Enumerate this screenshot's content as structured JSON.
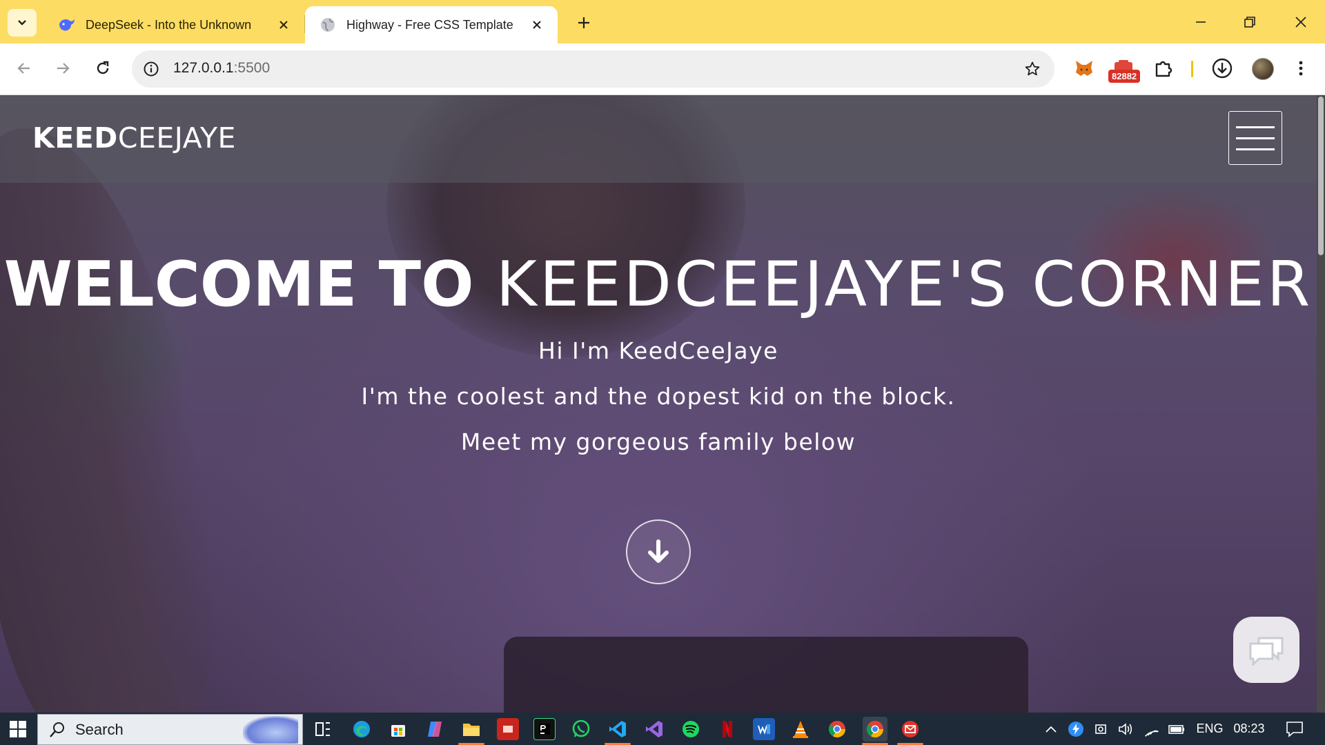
{
  "browser": {
    "tabs": [
      {
        "title": "DeepSeek - Into the Unknown",
        "favicon": "deepseek-whale-icon",
        "active": false
      },
      {
        "title": "Highway - Free CSS Template",
        "favicon": "globe-icon",
        "active": true
      }
    ],
    "address": {
      "host": "127.0.0.1",
      "port": ":5500"
    },
    "extension_badge": "82882",
    "colors": {
      "tabstrip": "#fcdc63",
      "active_tab": "#ffffff",
      "badge": "#d93025"
    }
  },
  "site": {
    "logo_bold": "KEED",
    "logo_light": "CEEJAYE",
    "hero": {
      "title_bold": "WELCOME TO",
      "title_light": "KEEDCEEJAYE'S CORNER",
      "lines": [
        "Hi I'm KeedCeeJaye",
        "I'm the coolest and the dopest kid on the block.",
        "Meet my gorgeous family below"
      ]
    }
  },
  "taskbar": {
    "search_label": "Search",
    "apps": [
      "task-view",
      "edge",
      "microsoft-store",
      "copilot",
      "file-explorer",
      "app-red",
      "pycharm",
      "whatsapp",
      "vscode",
      "visual-studio",
      "spotify",
      "netflix",
      "word",
      "vlc",
      "chrome",
      "chrome-active",
      "mail-app"
    ],
    "tray": {
      "language": "ENG",
      "time": "08:23"
    }
  }
}
